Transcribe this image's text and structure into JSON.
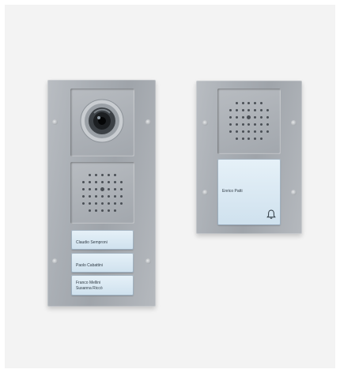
{
  "left_panel": {
    "nameplates": [
      {
        "lines": [
          "Claudio Semproni"
        ]
      },
      {
        "lines": [
          "Paolo Cabattini"
        ]
      },
      {
        "lines": [
          "Franco Mellini",
          "Susanna Riccò"
        ]
      }
    ]
  },
  "right_panel": {
    "nameplate": {
      "lines": [
        "Enrico Patti"
      ]
    },
    "bell_icon": "bell-icon"
  },
  "colors": {
    "background": "#f3f3f3",
    "panel_aluminium": "#a9aeb4",
    "nameplate_glass": "#d8e8f2"
  }
}
